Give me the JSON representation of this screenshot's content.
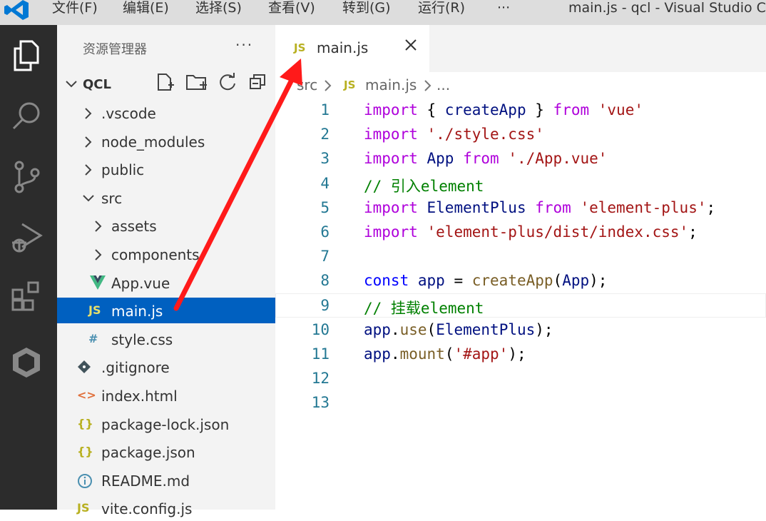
{
  "menu": [
    "文件(F)",
    "编辑(E)",
    "选择(S)",
    "查看(V)",
    "转到(G)",
    "运行(R)",
    "···"
  ],
  "window_title": "main.js - qcl - Visual Studio C",
  "explorer": {
    "header": "资源管理器",
    "more": "···",
    "project": "QCL",
    "tree": [
      {
        "label": ".vscode",
        "kind": "folder",
        "expanded": false,
        "depth": 1
      },
      {
        "label": "node_modules",
        "kind": "folder",
        "expanded": false,
        "depth": 1
      },
      {
        "label": "public",
        "kind": "folder",
        "expanded": false,
        "depth": 1
      },
      {
        "label": "src",
        "kind": "folder",
        "expanded": true,
        "depth": 1
      },
      {
        "label": "assets",
        "kind": "folder",
        "expanded": false,
        "depth": 2
      },
      {
        "label": "components",
        "kind": "folder",
        "expanded": false,
        "depth": 2
      },
      {
        "label": "App.vue",
        "kind": "vue",
        "depth": 2
      },
      {
        "label": "main.js",
        "kind": "js",
        "depth": 2,
        "selected": true
      },
      {
        "label": "style.css",
        "kind": "css",
        "depth": 2
      },
      {
        "label": ".gitignore",
        "kind": "git",
        "depth": 1
      },
      {
        "label": "index.html",
        "kind": "html",
        "depth": 1
      },
      {
        "label": "package-lock.json",
        "kind": "json",
        "depth": 1
      },
      {
        "label": "package.json",
        "kind": "json",
        "depth": 1
      },
      {
        "label": "README.md",
        "kind": "info",
        "depth": 1
      },
      {
        "label": "vite.config.js",
        "kind": "js",
        "depth": 1
      }
    ]
  },
  "icons": {
    "js": "JS",
    "css": "#",
    "json": "{}",
    "html": "<>"
  },
  "tab": {
    "label": "main.js",
    "icon": "JS"
  },
  "breadcrumb": {
    "folder": "src",
    "file": "main.js",
    "more": "..."
  },
  "code_lines": [
    {
      "n": "1",
      "tokens": [
        [
          "import",
          "kw-pink"
        ],
        [
          " { ",
          ""
        ],
        [
          "createApp",
          "var"
        ],
        [
          " } ",
          ""
        ],
        [
          "from",
          "kw-pink"
        ],
        [
          " ",
          ""
        ],
        [
          "'vue'",
          "str"
        ]
      ]
    },
    {
      "n": "2",
      "tokens": [
        [
          "import",
          "kw-pink"
        ],
        [
          " ",
          ""
        ],
        [
          "'./style.css'",
          "str"
        ]
      ]
    },
    {
      "n": "3",
      "tokens": [
        [
          "import",
          "kw-pink"
        ],
        [
          " ",
          ""
        ],
        [
          "App",
          "var"
        ],
        [
          " ",
          ""
        ],
        [
          "from",
          "kw-pink"
        ],
        [
          " ",
          ""
        ],
        [
          "'./App.vue'",
          "str"
        ]
      ]
    },
    {
      "n": "4",
      "tokens": [
        [
          "// 引入element",
          "com"
        ]
      ]
    },
    {
      "n": "5",
      "tokens": [
        [
          "import",
          "kw-pink"
        ],
        [
          " ",
          ""
        ],
        [
          "ElementPlus",
          "var"
        ],
        [
          " ",
          ""
        ],
        [
          "from",
          "kw-pink"
        ],
        [
          " ",
          ""
        ],
        [
          "'element-plus'",
          "str"
        ],
        [
          ";",
          ""
        ]
      ]
    },
    {
      "n": "6",
      "tokens": [
        [
          "import",
          "kw-pink"
        ],
        [
          " ",
          ""
        ],
        [
          "'element-plus/dist/index.css'",
          "str"
        ],
        [
          ";",
          ""
        ]
      ]
    },
    {
      "n": "7",
      "tokens": []
    },
    {
      "n": "8",
      "tokens": [
        [
          "const",
          "kw-blue"
        ],
        [
          " ",
          ""
        ],
        [
          "app",
          "var"
        ],
        [
          " = ",
          ""
        ],
        [
          "createApp",
          "fn"
        ],
        [
          "(",
          ""
        ],
        [
          "App",
          "var"
        ],
        [
          ");",
          ""
        ]
      ]
    },
    {
      "n": "9",
      "tokens": [
        [
          "// 挂载element",
          "com"
        ]
      ],
      "current": true
    },
    {
      "n": "10",
      "tokens": [
        [
          "app",
          "var"
        ],
        [
          ".",
          ""
        ],
        [
          "use",
          "fn"
        ],
        [
          "(",
          ""
        ],
        [
          "ElementPlus",
          "var"
        ],
        [
          ");",
          ""
        ]
      ]
    },
    {
      "n": "11",
      "tokens": [
        [
          "app",
          "var"
        ],
        [
          ".",
          ""
        ],
        [
          "mount",
          "fn"
        ],
        [
          "(",
          ""
        ],
        [
          "'#app'",
          "str"
        ],
        [
          ");",
          ""
        ]
      ]
    },
    {
      "n": "12",
      "tokens": []
    },
    {
      "n": "13",
      "tokens": []
    }
  ],
  "colors": {
    "accent": "#0060c0",
    "annotation": "#ff1a1a"
  }
}
